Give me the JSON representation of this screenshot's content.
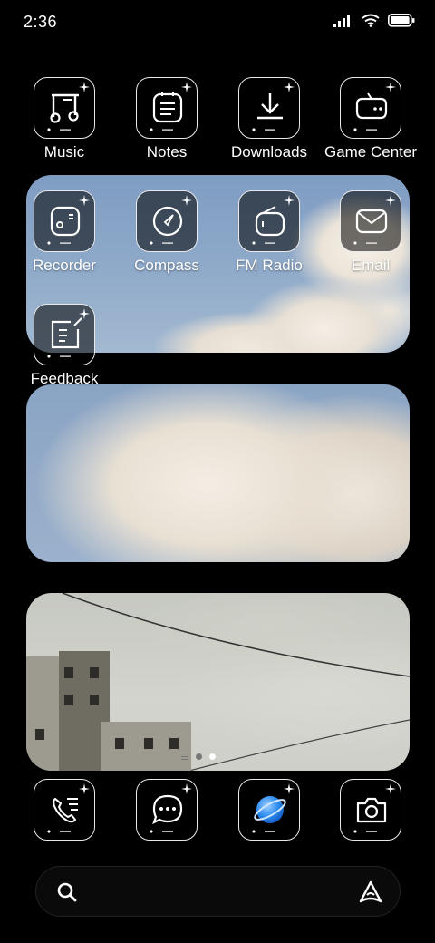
{
  "status_bar": {
    "time": "2:36"
  },
  "apps": {
    "row1": [
      {
        "label": "Music",
        "icon": "music-icon"
      },
      {
        "label": "Notes",
        "icon": "notes-icon"
      },
      {
        "label": "Downloads",
        "icon": "download-icon"
      },
      {
        "label": "Game Center",
        "icon": "gamepad-icon"
      }
    ],
    "row2": [
      {
        "label": "Recorder",
        "icon": "recorder-icon"
      },
      {
        "label": "Compass",
        "icon": "compass-icon"
      },
      {
        "label": "FM Radio",
        "icon": "radio-icon"
      },
      {
        "label": "Email",
        "icon": "mail-icon"
      }
    ],
    "row3": [
      {
        "label": "Feedback",
        "icon": "feedback-icon"
      }
    ]
  },
  "dock": [
    {
      "icon": "phone-icon"
    },
    {
      "icon": "messages-icon"
    },
    {
      "icon": "browser-icon"
    },
    {
      "icon": "camera-icon"
    }
  ],
  "page_indicator": {
    "pages": 2,
    "active": 2
  },
  "search": {
    "placeholder": ""
  },
  "colors": {
    "background": "#000000",
    "icon_outline": "#eaeaea",
    "browser_accent": "#2f8df0"
  }
}
